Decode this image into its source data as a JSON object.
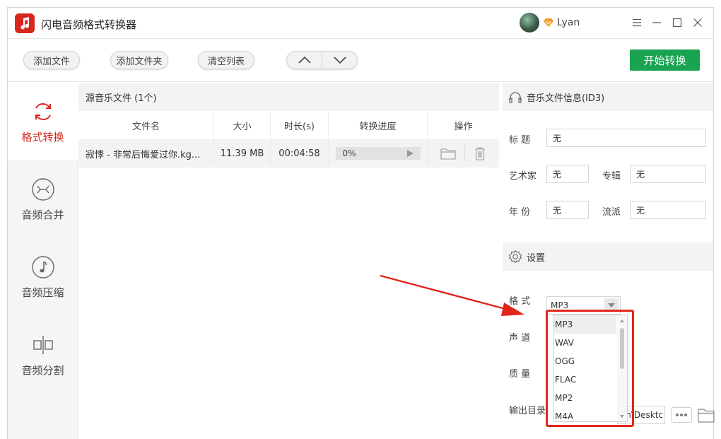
{
  "app": {
    "title": "闪电音频格式转换器",
    "user_name": "Lyan"
  },
  "toolbar": {
    "add_file": "添加文件",
    "add_folder": "添加文件夹",
    "clear_list": "清空列表",
    "start": "开始转换"
  },
  "sidebar": {
    "items": [
      {
        "label": "格式转换",
        "icon": "refresh-icon",
        "active": true
      },
      {
        "label": "音频合并",
        "icon": "merge-icon",
        "active": false
      },
      {
        "label": "音频压缩",
        "icon": "music-note-icon",
        "active": false
      },
      {
        "label": "音频分割",
        "icon": "split-icon",
        "active": false
      }
    ]
  },
  "file_list": {
    "header": "源音乐文件 (1个)",
    "columns": [
      "文件名",
      "大小",
      "时长(s)",
      "转换进度",
      "操作"
    ],
    "rows": [
      {
        "name": "寂悸 - 非常后悔爱过你.kg...",
        "size": "11.39 MB",
        "duration": "00:04:58",
        "progress_text": "0%",
        "progress": 0
      }
    ]
  },
  "id3": {
    "header": "音乐文件信息(ID3)",
    "title_label": "标 题",
    "title_value": "无",
    "artist_label": "艺术家",
    "artist_value": "无",
    "album_label": "专辑",
    "album_value": "无",
    "year_label": "年 份",
    "year_value": "无",
    "genre_label": "流派",
    "genre_value": "无"
  },
  "settings": {
    "header": "设置",
    "format_label": "格 式",
    "format_value": "MP3",
    "channel_label": "声 道",
    "quality_label": "质 量",
    "output_label": "输出目录",
    "output_value": "n\\Desktc",
    "format_options": [
      "MP3",
      "WAV",
      "OGG",
      "FLAC",
      "MP2",
      "M4A"
    ]
  },
  "colors": {
    "accent": "#d9261c",
    "start_button": "#1aa350",
    "annotation": "#e1251b"
  }
}
